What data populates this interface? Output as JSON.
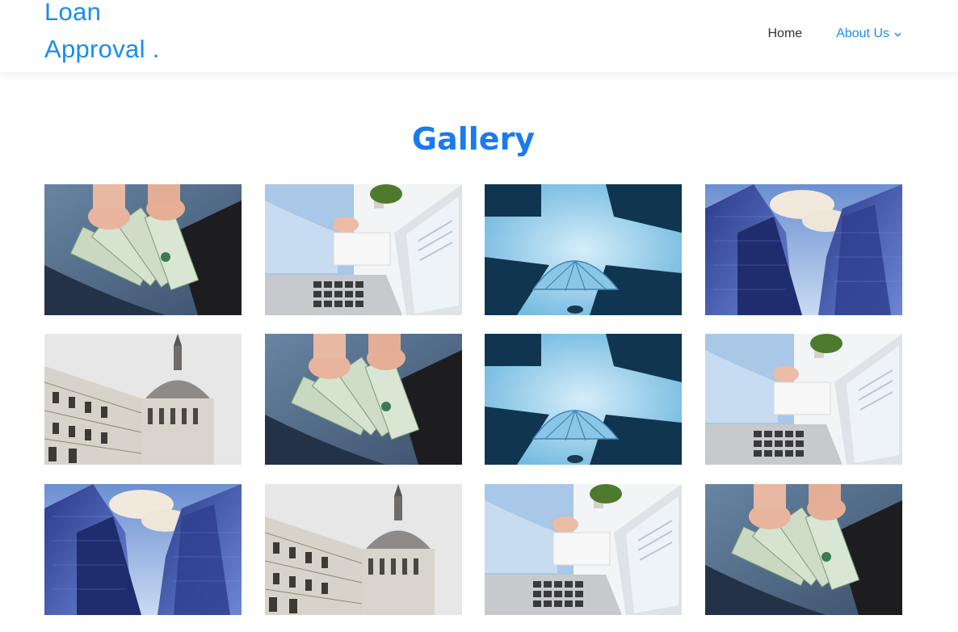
{
  "header": {
    "logo_line1": "Loan",
    "logo_line2": "Approval .",
    "nav": {
      "home": "Home",
      "about": "About Us"
    }
  },
  "main": {
    "title": "Gallery",
    "gallery": [
      {
        "subject": "money"
      },
      {
        "subject": "laptop"
      },
      {
        "subject": "umbrella"
      },
      {
        "subject": "skyscrapers"
      },
      {
        "subject": "dome-building"
      },
      {
        "subject": "money"
      },
      {
        "subject": "umbrella"
      },
      {
        "subject": "laptop"
      },
      {
        "subject": "skyscrapers"
      },
      {
        "subject": "dome-building"
      },
      {
        "subject": "laptop"
      },
      {
        "subject": "money"
      }
    ]
  },
  "colors": {
    "accent": "#1a8cf0",
    "title": "#1a7af0",
    "nav_text": "#333333"
  },
  "icons": {
    "about_dropdown": "chevron-down-icon"
  }
}
